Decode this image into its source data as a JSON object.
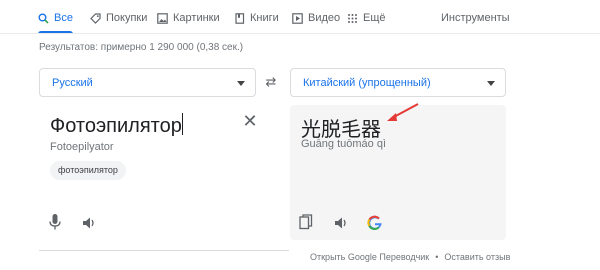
{
  "tabs": {
    "all": "Все",
    "shopping": "Покупки",
    "images": "Картинки",
    "books": "Книги",
    "video": "Видео",
    "more": "Ещё",
    "tools": "Инструменты"
  },
  "stats": "Результатов: примерно 1 290 000 (0,38 сек.)",
  "translator": {
    "source_language": "Русский",
    "target_language": "Китайский (упрощенный)",
    "source_text": "Фотоэпилятор",
    "source_transliteration": "Fotoepilyator",
    "suggestion_chip": "фотоэпилятор",
    "translated_text": "光脱毛器",
    "translated_transliteration": "Guāng tuōmáo qì",
    "footer_link": "Открыть Google Переводчик",
    "feedback_link": "Оставить отзыв"
  },
  "colors": {
    "accent": "#1a73e8",
    "annotation_arrow": "#e53935"
  },
  "icons": [
    "search-icon",
    "tag-icon",
    "image-icon",
    "book-icon",
    "play-icon",
    "dots-icon",
    "swap-icon",
    "close-icon",
    "microphone-icon",
    "speaker-icon",
    "copy-icon",
    "google-g-icon"
  ]
}
